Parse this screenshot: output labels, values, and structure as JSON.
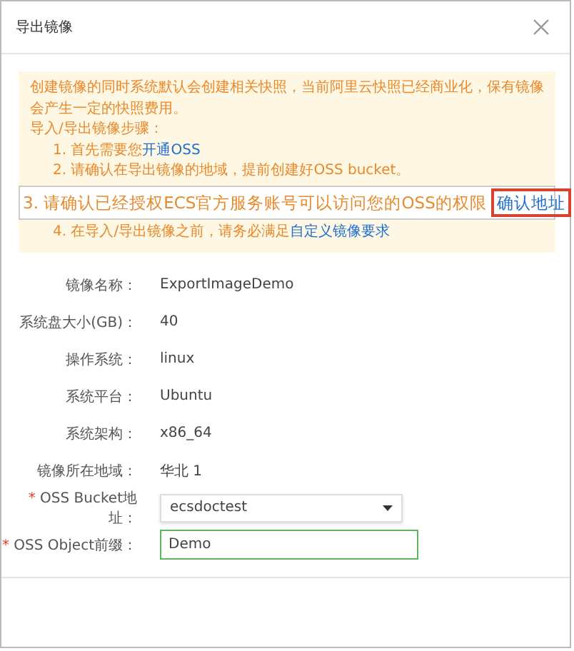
{
  "window": {
    "title": "导出镜像"
  },
  "notice": {
    "intro": "创建镜像的同时系统默认会创建相关快照，当前阿里云快照已经商业化，保有镜像会产生一定的快照费用。",
    "steps_heading": "导入/导出镜像步骤：",
    "steps": [
      {
        "kind": "step",
        "text": "1. 首先需要您",
        "link": "开通OSS"
      },
      {
        "kind": "step",
        "text": "2. 请确认在导出镜像的地域，提前创建好OSS bucket。"
      },
      {
        "kind": "callout",
        "text": "3. 请确认已经授权ECS官方服务账号可以访问您的OSS的权限",
        "link": "确认地址"
      },
      {
        "kind": "step",
        "text": "4. 在导入/导出镜像之前，请务必满足",
        "link": "自定义镜像要求"
      }
    ]
  },
  "fields": [
    {
      "kind": "text",
      "label": "镜像名称：",
      "value": "ExportImageDemo"
    },
    {
      "kind": "text",
      "label": "系统盘大小(GB)：",
      "value": "40"
    },
    {
      "kind": "text",
      "label": "操作系统：",
      "value": "linux"
    },
    {
      "kind": "text",
      "label": "系统平台：",
      "value": "Ubuntu"
    },
    {
      "kind": "text",
      "label": "系统架构：",
      "value": "x86_64"
    },
    {
      "kind": "text",
      "label": "镜像所在地域：",
      "value": "华北 1"
    },
    {
      "kind": "select",
      "marker": "*",
      "label": "OSS Bucket地址：",
      "value": "ecsdoctest"
    },
    {
      "kind": "input",
      "marker": "*",
      "label": "OSS Object前缀：",
      "value": "Demo",
      "focused": true
    }
  ]
}
